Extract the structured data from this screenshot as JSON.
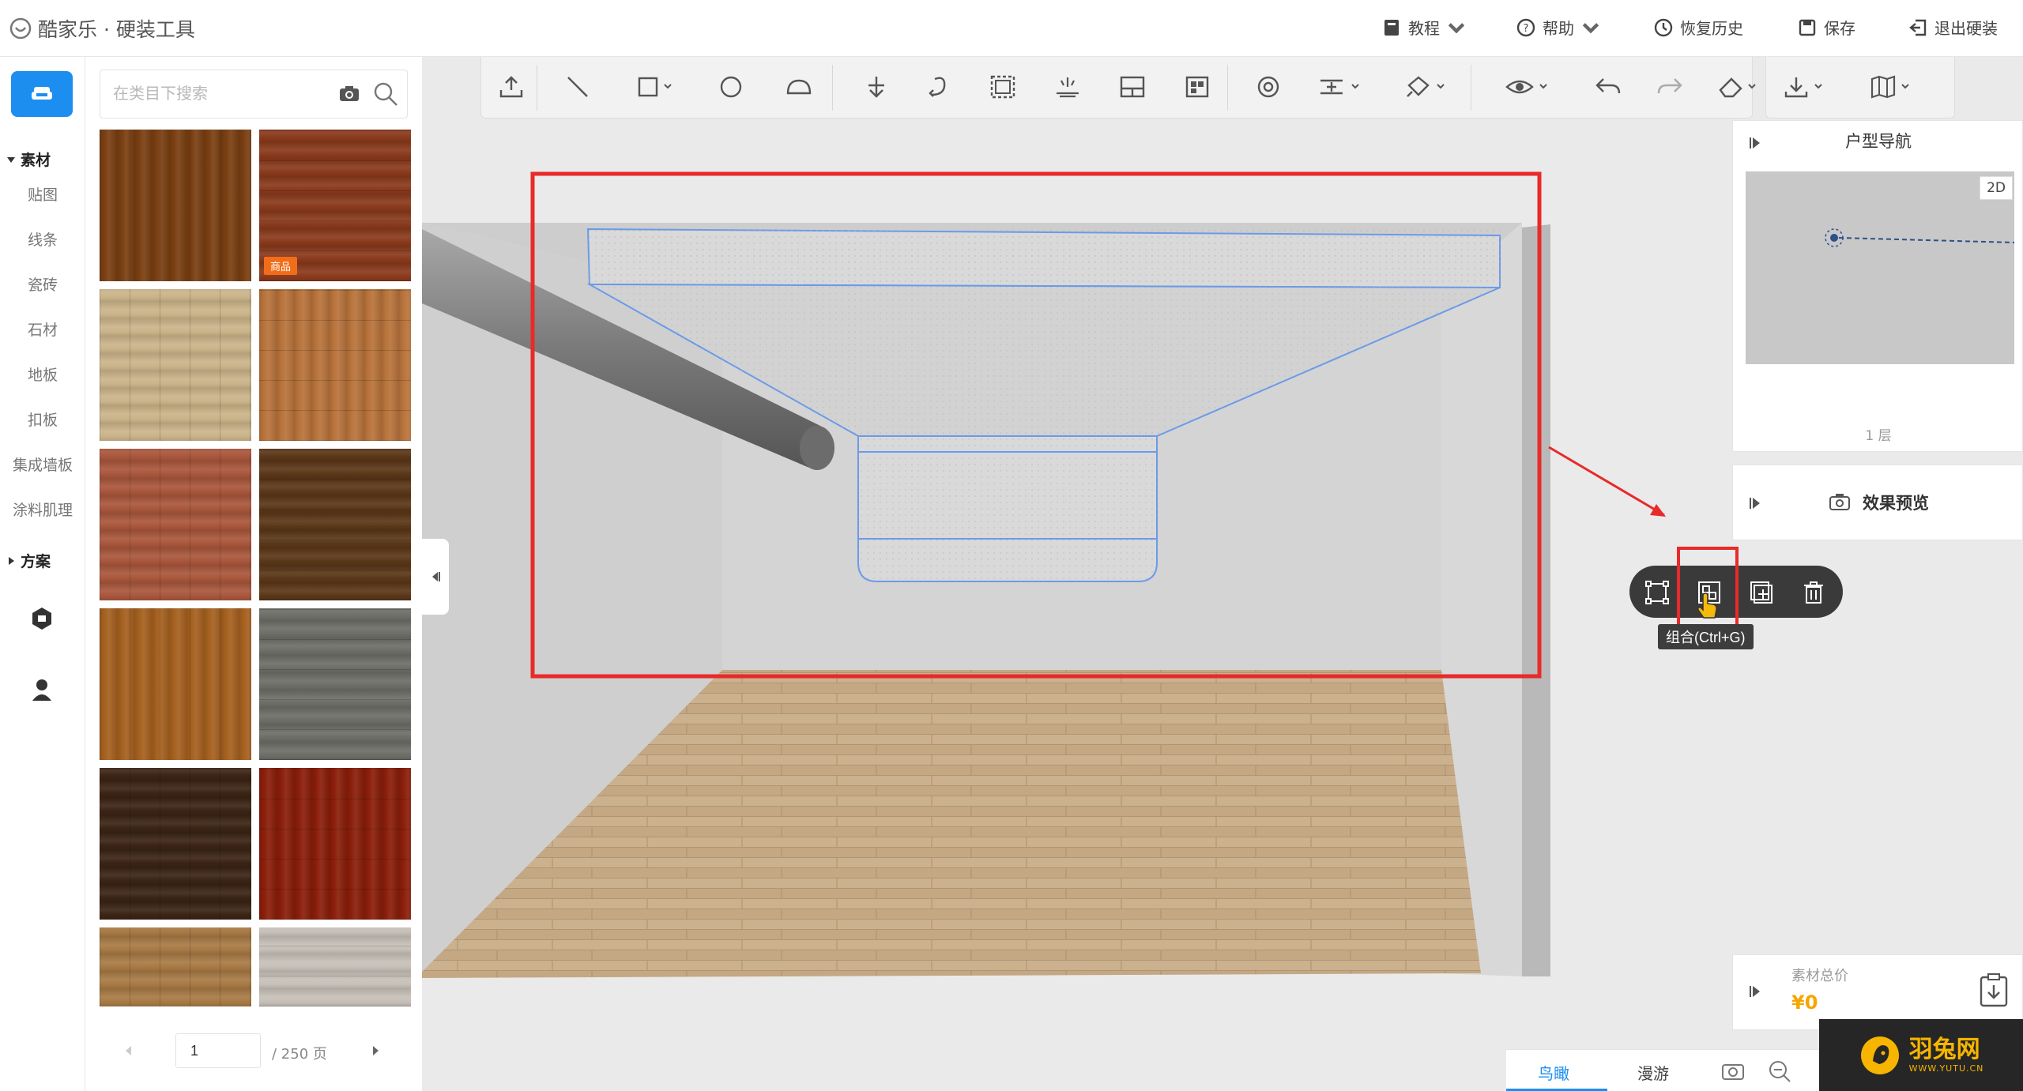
{
  "header": {
    "logo_text": "酷家乐 · 硬装工具",
    "buttons": [
      {
        "label": "教程",
        "icon": "book-icon"
      },
      {
        "label": "帮助",
        "icon": "help-icon"
      },
      {
        "label": "恢复历史",
        "icon": "clock-icon"
      },
      {
        "label": "保存",
        "icon": "save-icon"
      },
      {
        "label": "退出硬装",
        "icon": "exit-icon"
      }
    ]
  },
  "rail": {
    "sections": [
      {
        "label": "素材",
        "expanded": true,
        "items": [
          "贴图",
          "线条",
          "瓷砖",
          "石材",
          "地板",
          "扣板",
          "集成墙板",
          "涂料肌理"
        ]
      },
      {
        "label": "方案",
        "expanded": false
      }
    ]
  },
  "panel": {
    "search_placeholder": "在类目下搜索",
    "tiles": [
      {
        "name": "walnut-plank",
        "color": "#7a3f12"
      },
      {
        "name": "red-oak-strip",
        "color": "#8a3a1c",
        "badge": "商品"
      },
      {
        "name": "light-oak",
        "color": "#cbb48a"
      },
      {
        "name": "mixed-oak",
        "color": "#b8733b"
      },
      {
        "name": "red-herringbone",
        "color": "#a9573c"
      },
      {
        "name": "dark-parquet",
        "color": "#5b3718"
      },
      {
        "name": "honey-oak",
        "color": "#a5601f"
      },
      {
        "name": "grey-stone-wood",
        "color": "#6e6e68"
      },
      {
        "name": "dark-ebony",
        "color": "#3b2415"
      },
      {
        "name": "red-mahogany",
        "color": "#8a1e0a"
      },
      {
        "name": "patterned-oak",
        "color": "#a87a45"
      },
      {
        "name": "grey-wash",
        "color": "#c6c0b8"
      }
    ],
    "pager": {
      "current": "1",
      "total": "/ 250 页"
    }
  },
  "toolbar": {
    "icons": [
      "upload-icon",
      "line-icon",
      "rectangle-icon",
      "circle-icon",
      "arc-icon",
      "move-icon",
      "rotate-icon",
      "area-select-icon",
      "lighting-icon",
      "layout-icon",
      "grid-icon",
      "target-icon",
      "align-icon",
      "paint-icon",
      "view-icon",
      "undo-icon",
      "redo-icon",
      "eraser-icon",
      "download-icon",
      "map-icon"
    ]
  },
  "right_panels": {
    "nav_title": "户型导航",
    "nav_mode": "2D",
    "nav_floor": "1 层",
    "preview_label": "效果预览",
    "price_label": "素材总价",
    "price_value": "¥0"
  },
  "floating_toolbar": {
    "tooltip": "组合(Ctrl+G)",
    "buttons": [
      "transform-icon",
      "group-icon",
      "add-icon",
      "delete-icon"
    ]
  },
  "bottom": {
    "tabs": [
      "鸟瞰",
      "漫游"
    ],
    "active_tab": "鸟瞰"
  },
  "watermark": {
    "title": "羽兔网",
    "url": "WWW.YUTU.CN"
  },
  "colors": {
    "accent": "#1c8ef0",
    "highlight": "#e82a2a",
    "price": "#f7a500"
  }
}
